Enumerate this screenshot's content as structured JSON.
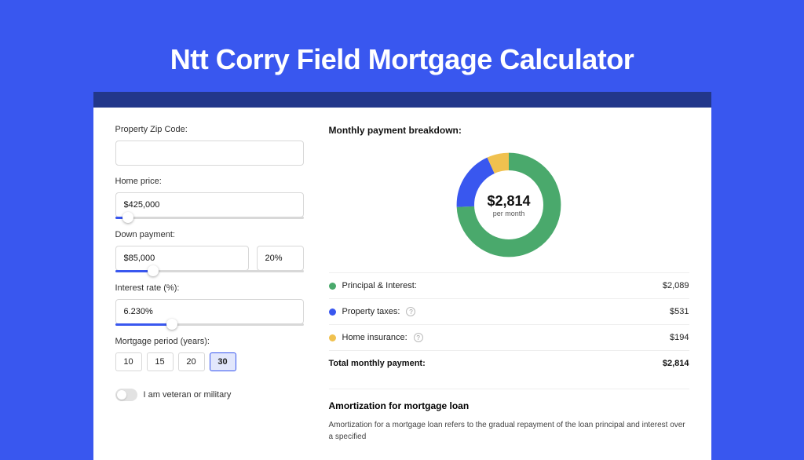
{
  "page": {
    "title": "Ntt Corry Field Mortgage Calculator"
  },
  "form": {
    "zip_label": "Property Zip Code:",
    "zip_value": "",
    "home_price_label": "Home price:",
    "home_price_value": "$425,000",
    "home_price_slider_pct": 7,
    "down_label": "Down payment:",
    "down_amount": "$85,000",
    "down_pct": "20%",
    "down_slider_pct": 20,
    "interest_label": "Interest rate (%):",
    "interest_value": "6.230%",
    "interest_slider_pct": 30,
    "period_label": "Mortgage period (years):",
    "periods": [
      "10",
      "15",
      "20",
      "30"
    ],
    "period_active": "30",
    "veteran_label": "I am veteran or military"
  },
  "breakdown": {
    "title": "Monthly payment breakdown:",
    "amount": "$2,814",
    "per": "per month",
    "items": [
      {
        "color": "green",
        "label": "Principal & Interest:",
        "value": "$2,089"
      },
      {
        "color": "blue",
        "label": "Property taxes:",
        "value": "$531",
        "info": true
      },
      {
        "color": "yellow",
        "label": "Home insurance:",
        "value": "$194",
        "info": true
      }
    ],
    "total_label": "Total monthly payment:",
    "total_value": "$2,814"
  },
  "amortization": {
    "title": "Amortization for mortgage loan",
    "text": "Amortization for a mortgage loan refers to the gradual repayment of the loan principal and interest over a specified"
  },
  "chart_data": {
    "type": "pie",
    "title": "Monthly payment breakdown",
    "series": [
      {
        "name": "Principal & Interest",
        "value": 2089,
        "color": "#4aa96c"
      },
      {
        "name": "Property taxes",
        "value": 531,
        "color": "#3957ef"
      },
      {
        "name": "Home insurance",
        "value": 194,
        "color": "#f0c14f"
      }
    ],
    "total": 2814,
    "center_label": "$2,814",
    "center_sub": "per month"
  }
}
